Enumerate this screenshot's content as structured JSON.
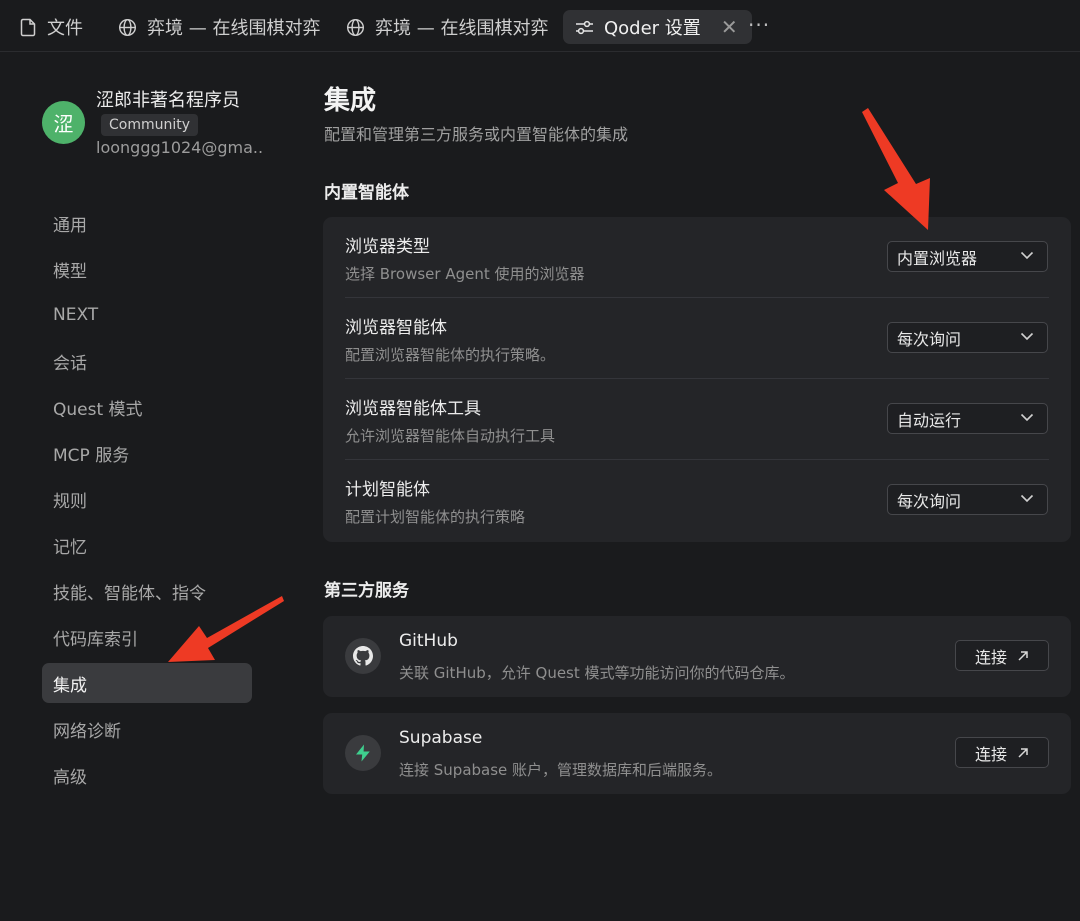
{
  "tabs": [
    {
      "label": "文件",
      "icon": "file-icon"
    },
    {
      "label": "弈境 — 在线围棋对弈",
      "icon": "globe-icon"
    },
    {
      "label": "弈境 — 在线围棋对弈",
      "icon": "globe-icon"
    },
    {
      "label": "Qoder 设置",
      "icon": "settings-sliders-icon",
      "active": true
    }
  ],
  "more_label": "···",
  "user": {
    "avatar_text": "涩",
    "name": "涩郎非著名程序员",
    "badge": "Community",
    "email": "loonggg1024@gma.."
  },
  "nav": {
    "items": [
      {
        "label": "通用"
      },
      {
        "label": "模型"
      },
      {
        "label": "NEXT"
      },
      {
        "label": "会话"
      },
      {
        "label": "Quest 模式"
      },
      {
        "label": "MCP 服务"
      },
      {
        "label": "规则"
      },
      {
        "label": "记忆"
      },
      {
        "label": "技能、智能体、指令"
      },
      {
        "label": "代码库索引"
      },
      {
        "label": "集成",
        "active": true
      },
      {
        "label": "网络诊断"
      },
      {
        "label": "高级"
      }
    ]
  },
  "main": {
    "title": "集成",
    "subtitle": "配置和管理第三方服务或内置智能体的集成",
    "builtin": {
      "heading": "内置智能体",
      "rows": [
        {
          "title": "浏览器类型",
          "desc": "选择 Browser Agent 使用的浏览器",
          "value": "内置浏览器"
        },
        {
          "title": "浏览器智能体",
          "desc": "配置浏览器智能体的执行策略。",
          "value": "每次询问"
        },
        {
          "title": "浏览器智能体工具",
          "desc": "允许浏览器智能体自动执行工具",
          "value": "自动运行"
        },
        {
          "title": "计划智能体",
          "desc": "配置计划智能体的执行策略",
          "value": "每次询问"
        }
      ]
    },
    "third_party": {
      "heading": "第三方服务",
      "services": [
        {
          "name": "GitHub",
          "desc": "关联 GitHub，允许 Quest 模式等功能访问你的代码仓库。",
          "button": "连接",
          "icon": "github-icon"
        },
        {
          "name": "Supabase",
          "desc": "连接 Supabase 账户，管理数据库和后端服务。",
          "button": "连接",
          "icon": "supabase-icon"
        }
      ]
    }
  },
  "colors": {
    "background": "#1a1b1d",
    "card": "#242528",
    "active_nav": "#3a3b3e",
    "avatar": "#4eb26a",
    "supabase": "#3ecf8e",
    "annotation_arrow": "#ee3a24"
  }
}
